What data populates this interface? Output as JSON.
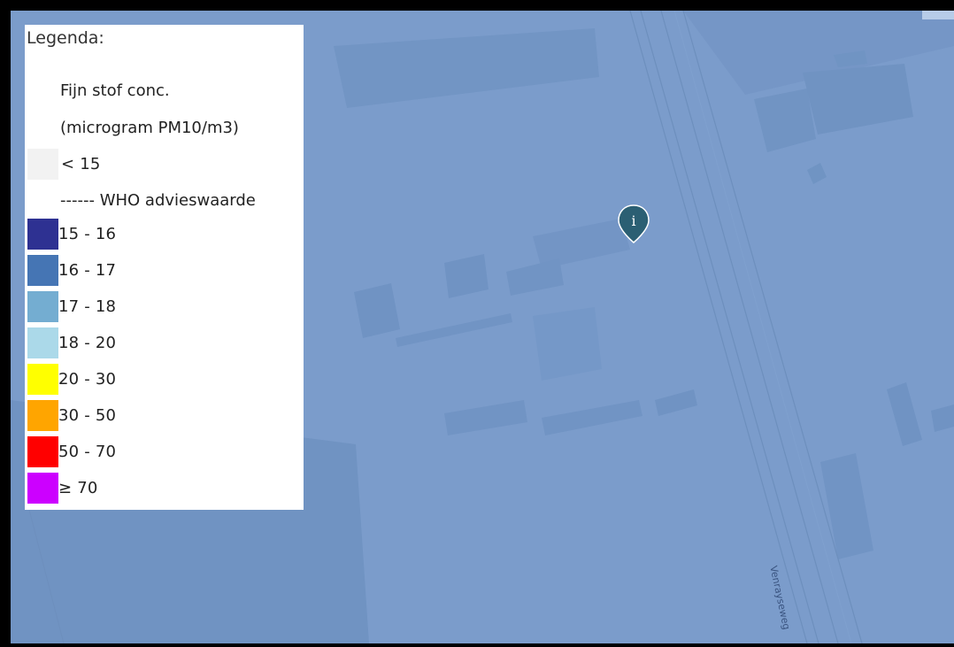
{
  "legend": {
    "title": "Legenda:",
    "heading_line1": "Fijn stof conc.",
    "heading_line2": "(microgram PM10/m3)",
    "below_label": "< 15",
    "below_color": "#f2f2f2",
    "who_label": "------ WHO advieswaarde",
    "classes": [
      {
        "label": "15 - 16",
        "color": "#2e3192"
      },
      {
        "label": "16 - 17",
        "color": "#4575b4"
      },
      {
        "label": "17 - 18",
        "color": "#74add1"
      },
      {
        "label": "18 - 20",
        "color": "#abd9e9"
      },
      {
        "label": "20 - 30",
        "color": "#ffff00"
      },
      {
        "label": "30 - 50",
        "color": "#ffa500"
      },
      {
        "label": "50 - 70",
        "color": "#ff0000"
      },
      {
        "label": "≥ 70",
        "color": "#cc00ff"
      }
    ]
  },
  "map": {
    "background_color": "#7b9ccb",
    "street_label": "Venrayseweg",
    "marker_icon": "info-marker-icon",
    "marker_glyph": "i",
    "marker_color": "#2b5f73"
  }
}
